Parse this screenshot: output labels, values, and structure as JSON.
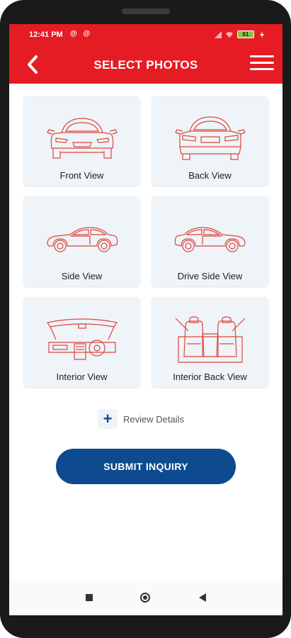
{
  "status_bar": {
    "time": "12:41 PM",
    "app_icons": "@ @",
    "battery": "61"
  },
  "app_bar": {
    "title": "SELECT PHOTOS",
    "back_icon": "chevron-left-icon",
    "menu_icon": "hamburger-menu-icon"
  },
  "photo_options": [
    {
      "label": "Front View",
      "icon": "car-front-icon"
    },
    {
      "label": "Back View",
      "icon": "car-back-icon"
    },
    {
      "label": "Side View",
      "icon": "car-side-icon"
    },
    {
      "label": "Drive Side View",
      "icon": "car-drive-side-icon"
    },
    {
      "label": "Interior View",
      "icon": "car-interior-dashboard-icon"
    },
    {
      "label": "Interior Back View",
      "icon": "car-interior-seats-icon"
    }
  ],
  "review": {
    "icon": "plus-icon",
    "label": "Review Details"
  },
  "submit": {
    "label": "SUBMIT INQUIRY"
  },
  "colors": {
    "brand_red": "#e51c23",
    "primary_blue": "#0d4a8f",
    "card_bg": "#eef4f8",
    "line_art": "#e0443a"
  }
}
